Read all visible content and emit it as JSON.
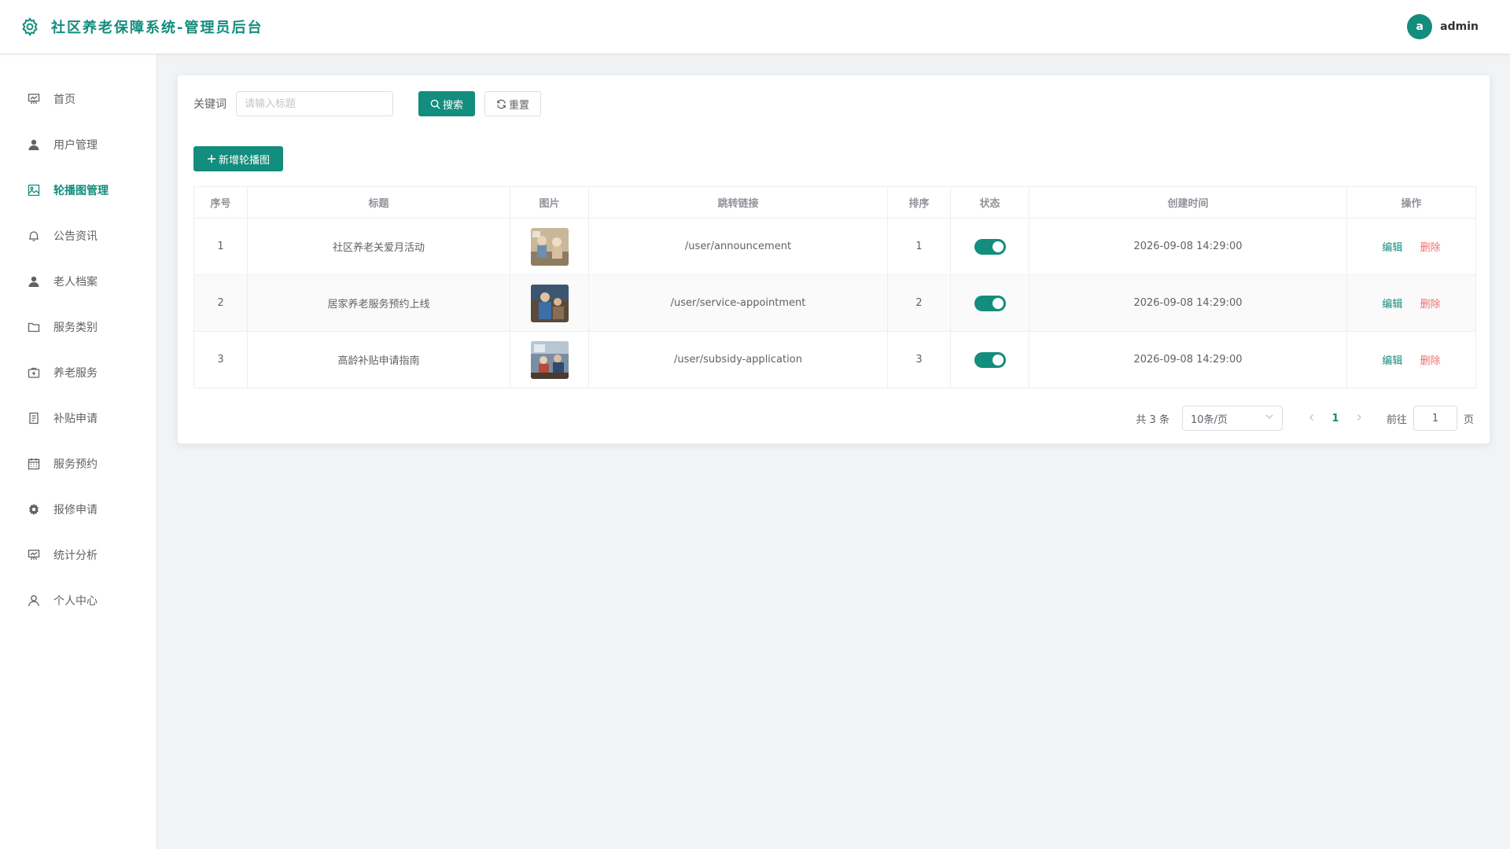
{
  "header": {
    "title": "社区养老保障系统-管理员后台",
    "avatar_letter": "a",
    "username": "admin"
  },
  "sidebar": {
    "items": [
      {
        "label": "首页",
        "icon": "presentation-icon"
      },
      {
        "label": "用户管理",
        "icon": "user-icon"
      },
      {
        "label": "轮播图管理",
        "icon": "picture-icon"
      },
      {
        "label": "公告资讯",
        "icon": "bell-icon"
      },
      {
        "label": "老人档案",
        "icon": "user-icon"
      },
      {
        "label": "服务类别",
        "icon": "folder-icon"
      },
      {
        "label": "养老服务",
        "icon": "first-aid-kit-icon"
      },
      {
        "label": "补贴申请",
        "icon": "document-icon"
      },
      {
        "label": "服务预约",
        "icon": "calendar-icon"
      },
      {
        "label": "报修申请",
        "icon": "gear-icon"
      },
      {
        "label": "统计分析",
        "icon": "presentation-icon"
      },
      {
        "label": "个人中心",
        "icon": "user-outline-icon"
      }
    ],
    "active_index": 2
  },
  "search": {
    "label": "关键词",
    "placeholder": "请输入标题",
    "value": "",
    "search_button": "搜索",
    "reset_button": "重置"
  },
  "add_button": "新增轮播图",
  "table": {
    "headers": [
      "序号",
      "标题",
      "图片",
      "跳转链接",
      "排序",
      "状态",
      "创建时间",
      "操作"
    ],
    "rows": [
      {
        "index": "1",
        "title": "社区养老关爱月活动",
        "link": "/user/announcement",
        "sort": "1",
        "status": true,
        "created": "2026-09-08 14:29:00"
      },
      {
        "index": "2",
        "title": "居家养老服务预约上线",
        "link": "/user/service-appointment",
        "sort": "2",
        "status": true,
        "created": "2026-09-08 14:29:00"
      },
      {
        "index": "3",
        "title": "高龄补贴申请指南",
        "link": "/user/subsidy-application",
        "sort": "3",
        "status": true,
        "created": "2026-09-08 14:29:00"
      }
    ],
    "edit_label": "编辑",
    "delete_label": "删除"
  },
  "pagination": {
    "total_text": "共 3 条",
    "page_size": "10条/页",
    "current_page": "1",
    "goto_label": "前往",
    "goto_value": "1",
    "goto_suffix": "页"
  },
  "colors": {
    "primary": "#138d7d",
    "danger": "#f56c6c"
  }
}
